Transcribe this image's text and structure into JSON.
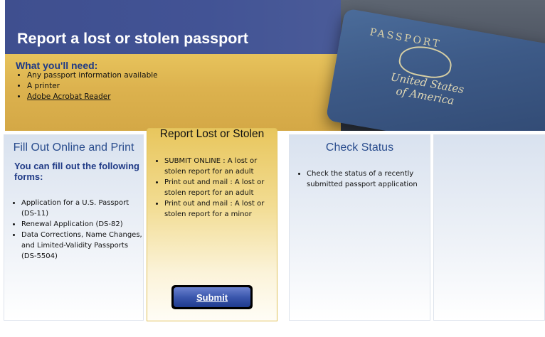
{
  "hero": {
    "title": "Report a lost or stolen passport",
    "need_title": "What you'll need:",
    "need_items": [
      "Any passport information available",
      "A printer",
      "Adobe Acrobat Reader"
    ],
    "photo": {
      "cover_word": "PASSPORT",
      "country_line1": "United States",
      "country_line2": "of America"
    }
  },
  "fill_out": {
    "title": "Fill Out Online and Print",
    "subtitle": "You can fill out the following forms:",
    "items": [
      "Application for a U.S. Passport (DS-11)",
      "Renewal Application (DS-82)",
      "Data Corrections, Name Changes, and Limited-Validity Passports (DS-5504)"
    ]
  },
  "report": {
    "title": "Report Lost or Stolen",
    "items": [
      "SUBMIT ONLINE : A lost or stolen report for an adult",
      "Print out and mail : A lost or stolen report for an adult",
      "Print out and mail : A lost or stolen report for a minor"
    ],
    "submit_label": "Submit"
  },
  "status": {
    "title": "Check Status",
    "items": [
      "Check the status of a recently submitted passport application"
    ]
  },
  "colors": {
    "header_blue": "#425395",
    "title_blue": "#1f3a86",
    "gold": "#e8c65d"
  }
}
